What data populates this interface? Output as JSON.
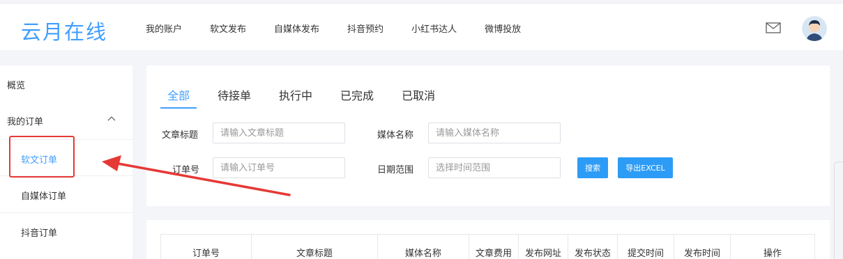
{
  "brand": {
    "logo": "云月在线",
    "accent": "#409eff"
  },
  "nav": [
    "我的账户",
    "软文发布",
    "自媒体发布",
    "抖音预约",
    "小红书达人",
    "微博投放"
  ],
  "sidebar": {
    "overview": "概览",
    "my_orders": "我的订单",
    "sub_items": [
      "软文订单",
      "自媒体订单",
      "抖音订单"
    ],
    "active": "软文订单"
  },
  "tabs": [
    "全部",
    "待接单",
    "执行中",
    "已完成",
    "已取消"
  ],
  "filters": {
    "title_label": "文章标题",
    "title_placeholder": "请输入文章标题",
    "media_label": "媒体名称",
    "media_placeholder": "请输入媒体名称",
    "order_label": "订单号",
    "order_placeholder": "请输入订单号",
    "date_label": "日期范围",
    "date_placeholder": "选择时间范围",
    "search_button": "搜索",
    "export_button": "导出EXCEL"
  },
  "table": {
    "columns": [
      "订单号",
      "文章标题",
      "媒体名称",
      "文章费用",
      "发布网址",
      "发布状态",
      "提交时间",
      "发布时间",
      "操作"
    ]
  },
  "annotation_color": "#e53935"
}
